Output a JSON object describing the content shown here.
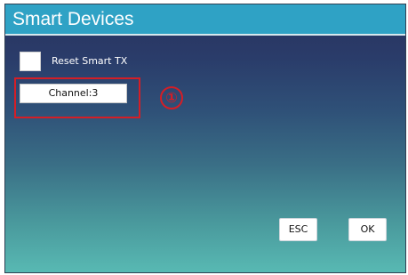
{
  "window": {
    "title": "Smart Devices"
  },
  "options": {
    "reset_checkbox_checked": false,
    "reset_label": "Reset Smart TX"
  },
  "channel": {
    "value": "Channel:3"
  },
  "annotation": {
    "marker": "①",
    "color": "#d41e26"
  },
  "buttons": {
    "esc_label": "ESC",
    "ok_label": "OK"
  },
  "colors": {
    "title_bar": "#2fa2c5",
    "gradient_top": "#28325e",
    "gradient_bottom": "#58b9b3"
  }
}
